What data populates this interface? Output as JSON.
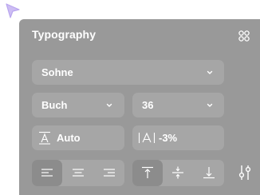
{
  "panel": {
    "title": "Typography",
    "font_family": "Sohne",
    "font_weight": "Buch",
    "font_size": "36",
    "line_height": "Auto",
    "letter_spacing": "-3%",
    "text_align_options": [
      "left",
      "center",
      "right"
    ],
    "text_align_selected": "left",
    "vertical_align_options": [
      "top",
      "middle",
      "bottom"
    ],
    "vertical_align_selected": "top"
  },
  "icons": {
    "cursor": "cursor-arrow-icon",
    "more": "grid-dots-icon",
    "line_height": "line-height-icon",
    "letter_spacing": "letter-spacing-icon",
    "adjust": "sliders-icon"
  },
  "colors": {
    "panel_bg": "#999999",
    "field_bg": "#a6a6a6",
    "active_bg": "#8c8c8c",
    "text": "#ffffff",
    "cursor": "#c9b8f2"
  }
}
